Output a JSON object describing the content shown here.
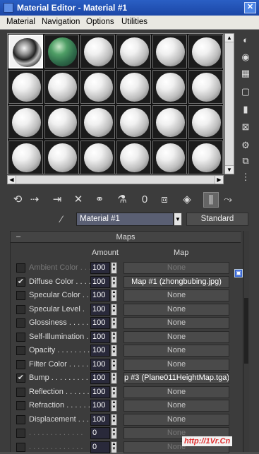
{
  "window": {
    "title": "Material Editor - Material #1",
    "close": "✕"
  },
  "menu": [
    "Material",
    "Navigation",
    "Options",
    "Utilities"
  ],
  "slots": [
    {
      "kind": "chrome"
    },
    {
      "kind": "green"
    },
    {
      "kind": "blank"
    },
    {
      "kind": "blank"
    },
    {
      "kind": "blank"
    },
    {
      "kind": "blank"
    },
    {
      "kind": "blank"
    },
    {
      "kind": "blank"
    },
    {
      "kind": "blank"
    },
    {
      "kind": "blank"
    },
    {
      "kind": "blank"
    },
    {
      "kind": "blank"
    },
    {
      "kind": "blank"
    },
    {
      "kind": "blank"
    },
    {
      "kind": "blank"
    },
    {
      "kind": "blank"
    },
    {
      "kind": "blank"
    },
    {
      "kind": "blank"
    },
    {
      "kind": "blank"
    },
    {
      "kind": "blank"
    },
    {
      "kind": "blank"
    },
    {
      "kind": "blank"
    },
    {
      "kind": "blank"
    },
    {
      "kind": "blank"
    }
  ],
  "right_tools": [
    "sample-type-icon",
    "backlight-icon",
    "background-icon",
    "sample-uv-tiling-icon",
    "video-color-check-icon",
    "make-preview-icon",
    "options-icon",
    "select-by-material-icon",
    "material-navigator-icon"
  ],
  "hbar_tools": [
    "get-material-icon",
    "put-to-scene-icon",
    "assign-to-selection-icon",
    "reset-map-icon",
    "make-unique-icon",
    "put-to-library-icon",
    "material-effects-channel-icon",
    "show-map-in-viewport-icon",
    "show-end-result-icon",
    "go-to-parent-icon",
    "go-forward-to-sibling-icon"
  ],
  "effects_channel": "0",
  "name_row": {
    "material_name": "Material #1",
    "type_button": "Standard"
  },
  "rollout": {
    "toggle": "–",
    "title": "Maps"
  },
  "columns": {
    "amount": "Amount",
    "map": "Map"
  },
  "maps": [
    {
      "label": "Ambient Color . . .",
      "checked": false,
      "amount": "100",
      "map": "None",
      "active": false,
      "dim": true
    },
    {
      "label": "Diffuse Color . . . .",
      "checked": true,
      "amount": "100",
      "map": "Map #1 (zhongbubing.jpg)",
      "active": true,
      "dim": false
    },
    {
      "label": "Specular Color . .",
      "checked": false,
      "amount": "100",
      "map": "None",
      "active": false,
      "dim": false
    },
    {
      "label": "Specular Level .",
      "checked": false,
      "amount": "100",
      "map": "None",
      "active": false,
      "dim": false
    },
    {
      "label": "Glossiness . . . . . .",
      "checked": false,
      "amount": "100",
      "map": "None",
      "active": false,
      "dim": false
    },
    {
      "label": "Self-Illumination .",
      "checked": false,
      "amount": "100",
      "map": "None",
      "active": false,
      "dim": false
    },
    {
      "label": "Opacity . . . . . . . .",
      "checked": false,
      "amount": "100",
      "map": "None",
      "active": false,
      "dim": false
    },
    {
      "label": "Filter Color . . . . .",
      "checked": false,
      "amount": "100",
      "map": "None",
      "active": false,
      "dim": false
    },
    {
      "label": "Bump . . . . . . . . .",
      "checked": true,
      "amount": "100",
      "map": "p #3 (Plane011HeightMap.tga)",
      "active": true,
      "dim": false
    },
    {
      "label": "Reflection . . . . . .",
      "checked": false,
      "amount": "100",
      "map": "None",
      "active": false,
      "dim": false
    },
    {
      "label": "Refraction . . . . . .",
      "checked": false,
      "amount": "100",
      "map": "None",
      "active": false,
      "dim": false
    },
    {
      "label": "Displacement . . .",
      "checked": false,
      "amount": "100",
      "map": "None",
      "active": false,
      "dim": false
    },
    {
      "label": ". . . . . . . . . . . . .",
      "checked": false,
      "amount": "0",
      "map": "None",
      "active": false,
      "dim": true
    },
    {
      "label": ". . . . . . . . . . . . .",
      "checked": false,
      "amount": "0",
      "map": "None",
      "active": false,
      "dim": true
    }
  ],
  "watermark": "http://1Vr.Cn"
}
